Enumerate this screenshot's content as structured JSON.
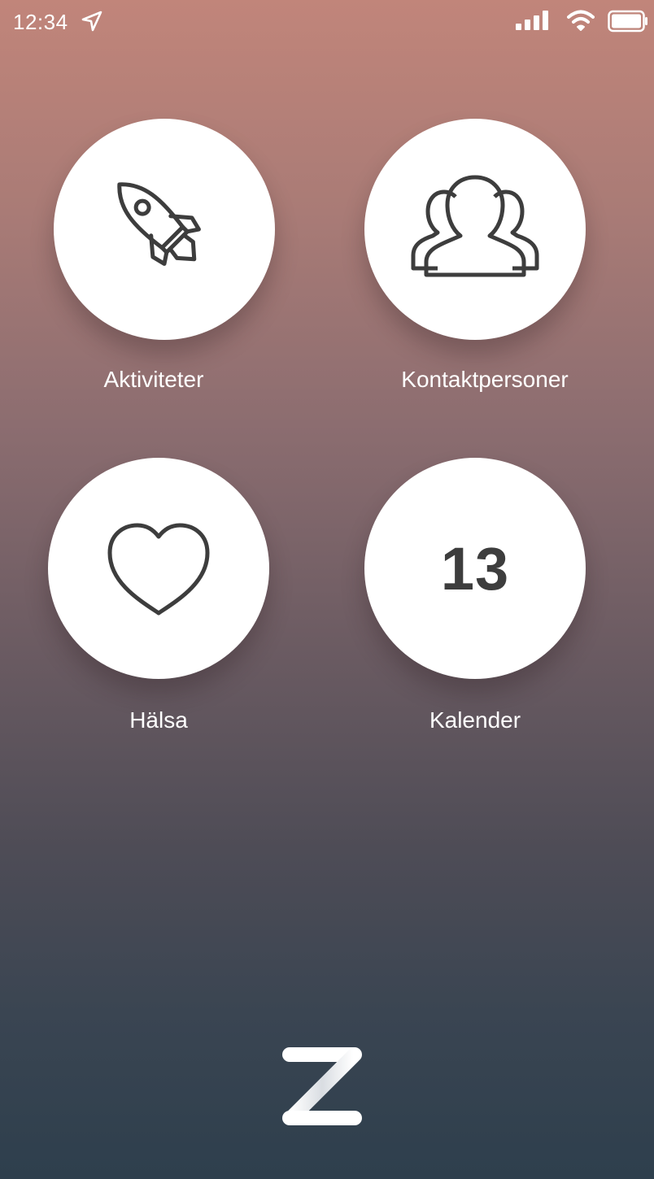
{
  "status_bar": {
    "time": "12:34",
    "icons": [
      "location-arrow-icon",
      "signal-bars-icon",
      "wifi-icon",
      "battery-icon"
    ]
  },
  "tiles": [
    {
      "label": "Aktiviteter",
      "icon": "rocket-icon"
    },
    {
      "label": "Kontaktpersoner",
      "icon": "people-group-icon"
    },
    {
      "label": "Hälsa",
      "icon": "heart-icon"
    },
    {
      "label": "Kalender",
      "icon": "calendar-number-icon",
      "number": "13"
    }
  ],
  "logo": {
    "icon": "z-logo-icon"
  },
  "colors": {
    "gradient_top": "#c1857a",
    "gradient_bottom": "#2e3f4d",
    "tile_background": "#ffffff",
    "icon_stroke": "#3d3d3d",
    "label_text": "#ffffff"
  }
}
